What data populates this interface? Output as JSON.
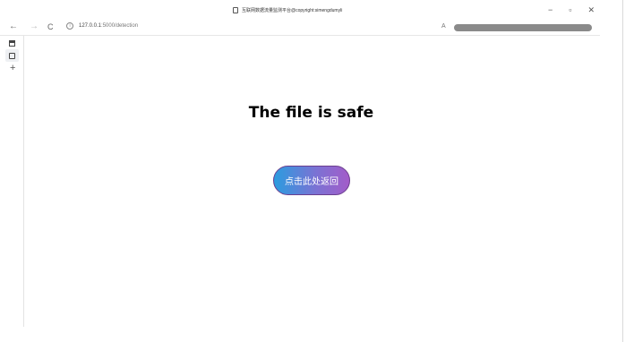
{
  "tab": {
    "title": "互联网数据流量监测平台@copyright:simengdumyli"
  },
  "window": {
    "minimize": "−",
    "maximize": "▫",
    "close": "✕"
  },
  "nav": {
    "back": "←",
    "forward": "→",
    "reload": "C",
    "info": "i",
    "url_host": "127.0.0.1",
    "url_path": ":5000/detection",
    "reader_icon": "A"
  },
  "sidebar": {
    "add": "+"
  },
  "main": {
    "heading": "The file is safe",
    "back_button_label": "点击此处返回"
  }
}
